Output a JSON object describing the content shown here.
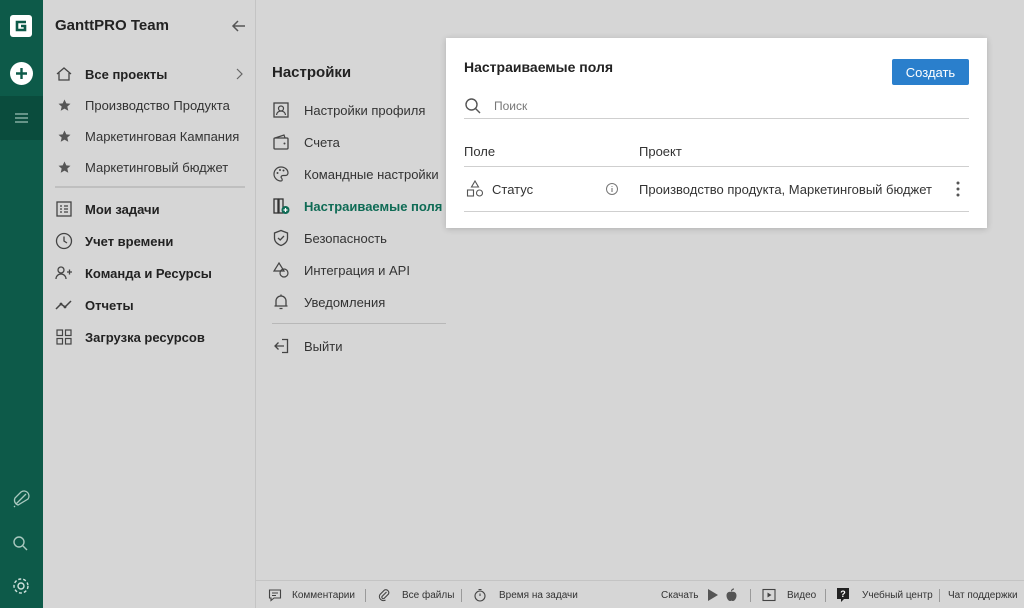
{
  "app": {
    "team_name": "GanttPRO Team",
    "accent_color": "#0d5a49",
    "primary_button_color": "#2a7fcc"
  },
  "rail": {
    "icons": [
      "ganttpro-logo-icon",
      "add-icon",
      "menu-icon",
      "bell-icon",
      "search-icon",
      "settings-icon"
    ]
  },
  "sidebar": {
    "projects": [
      {
        "label": "Все проекты",
        "icon": "home-icon"
      },
      {
        "label": "Производство Продукта",
        "icon": "star-icon"
      },
      {
        "label": "Маркетинговая Кампания",
        "icon": "star-icon"
      },
      {
        "label": "Маркетинговый бюджет",
        "icon": "star-icon"
      }
    ],
    "tools": [
      {
        "label": "Мои задачи",
        "icon": "tasks-icon"
      },
      {
        "label": "Учет времени",
        "icon": "clock-icon"
      },
      {
        "label": "Команда и Ресурсы",
        "icon": "team-icon"
      },
      {
        "label": "Отчеты",
        "icon": "reports-icon"
      },
      {
        "label": "Загрузка ресурсов",
        "icon": "grid-icon"
      }
    ]
  },
  "settings": {
    "title": "Настройки",
    "items": [
      {
        "label": "Настройки профиля",
        "icon": "profile-icon"
      },
      {
        "label": "Счета",
        "icon": "wallet-icon"
      },
      {
        "label": "Командные настройки",
        "icon": "palette-icon"
      },
      {
        "label": "Настраиваемые поля",
        "icon": "custom-fields-icon",
        "active": true
      },
      {
        "label": "Безопасность",
        "icon": "shield-icon"
      },
      {
        "label": "Интеграция и API",
        "icon": "shapes-icon"
      },
      {
        "label": "Уведомления",
        "icon": "bell-icon"
      }
    ],
    "logout": "Выйти"
  },
  "custom_fields": {
    "title": "Настраиваемые поля",
    "create_label": "Создать",
    "search_placeholder": "Поиск",
    "columns": [
      "Поле",
      "Проект"
    ],
    "rows": [
      {
        "field": "Статус",
        "project": "Производство продукта, Маркетинговый бюджет"
      }
    ]
  },
  "footer": {
    "comments": "Комментарии",
    "files": "Все файлы",
    "time": "Время на задачи",
    "download": "Скачать",
    "video": "Видео",
    "help_center": "Учебный центр",
    "support_chat": "Чат поддержки"
  }
}
